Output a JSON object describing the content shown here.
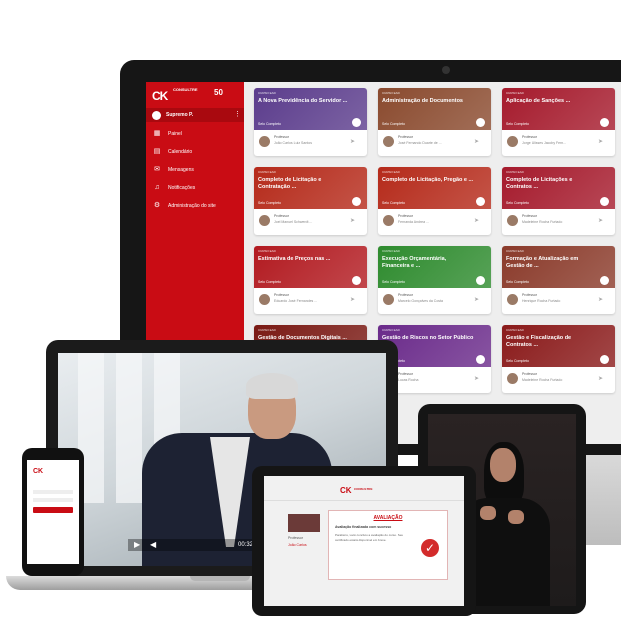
{
  "sidebar": {
    "logo": "CK",
    "brand": "CONSULTRE",
    "badge": "50",
    "user": "Supremo P.",
    "items": [
      {
        "label": "Painel",
        "icon": "dashboard-icon",
        "glyph": "▦"
      },
      {
        "label": "Calendário",
        "icon": "calendar-icon",
        "glyph": "▤"
      },
      {
        "label": "Mensagens",
        "icon": "messages-icon",
        "glyph": "✉"
      },
      {
        "label": "Notificações",
        "icon": "bell-icon",
        "glyph": "♫"
      },
      {
        "label": "Administração do site",
        "icon": "gear-icon",
        "glyph": "⚙"
      }
    ]
  },
  "courses": [
    {
      "tag": "CURSO EAD",
      "title": "A Nova Previdência do Servidor ...",
      "seal": "Selo Completo",
      "color": "#5b3c8c",
      "teacher_label": "Professor",
      "teacher": "João Carlos Luiz Santos"
    },
    {
      "tag": "CURSO EAD",
      "title": "Administração de Documentos",
      "seal": "Selo Completo",
      "color": "#8a4a2e",
      "teacher_label": "Professor",
      "teacher": "José Fernando Duarte de ..."
    },
    {
      "tag": "CURSO EAD",
      "title": "Aplicação de Sanções ...",
      "seal": "Selo Completo",
      "color": "#a51a2c",
      "teacher_label": "Professor",
      "teacher": "Jorge Ulisses Jacoby Fern..."
    },
    {
      "tag": "CURSO EAD",
      "title": "Completo de Licitação e Contratação ...",
      "seal": "Selo Completo",
      "color": "#b52a1a",
      "teacher_label": "Professor",
      "teacher": "Joel Manuel Schwerdt ..."
    },
    {
      "tag": "CURSO EAD",
      "title": "Completo de Licitação, Pregão e ...",
      "seal": "Selo Completo",
      "color": "#b52a1a",
      "teacher_label": "Professor",
      "teacher": "Fernanda Andrea ..."
    },
    {
      "tag": "CURSO EAD",
      "title": "Completo de Licitações e Contratos ...",
      "seal": "Selo Completo",
      "color": "#a51a2c",
      "teacher_label": "Professor",
      "teacher": "Madeleine Rocha Furtado"
    },
    {
      "tag": "CURSO EAD",
      "title": "Estimativa de Preços nas ...",
      "seal": "Selo Completo",
      "color": "#b21a20",
      "teacher_label": "Professor",
      "teacher": "Eduardo José Fernandes ..."
    },
    {
      "tag": "CURSO EAD",
      "title": "Execução Orçamentária, Financeira e ...",
      "seal": "Selo Completo",
      "color": "#2e8b2e",
      "teacher_label": "Professor",
      "teacher": "Marcelo Gonçalves da Costa"
    },
    {
      "tag": "CURSO EAD",
      "title": "Formação e Atualização em Gestão de ...",
      "seal": "Selo Completo",
      "color": "#8a3a2a",
      "teacher_label": "Professor",
      "teacher": "Henrique Rocha Furtado"
    },
    {
      "tag": "CURSO EAD",
      "title": "Gestão de Documentos Digitais ...",
      "seal": "Selo Completo",
      "color": "#7a1a14",
      "teacher_label": "Professor",
      "teacher": "Luiz ..."
    },
    {
      "tag": "CURSO EAD",
      "title": "Gestão de Riscos no Setor Público",
      "seal": "Selo Completo",
      "color": "#6a2a8a",
      "teacher_label": "Professor",
      "teacher": "Lucas Rocha"
    },
    {
      "tag": "CURSO EAD",
      "title": "Gestão e Fiscalização de Contratos ...",
      "seal": "Selo Completo",
      "color": "#8a1a1a",
      "teacher_label": "Professor",
      "teacher": "Madeleine Rocha Furtado"
    }
  ],
  "video": {
    "time": "00:32"
  },
  "phone": {
    "logo": "CK"
  },
  "tablet": {
    "logo": "CK",
    "brand": "CONSULTRE",
    "side_label": "Professor",
    "side_label2": "João Carlos",
    "dialog_title": "AVALIAÇÃO",
    "dialog_sub": "Avaliação finalizada com sucesso",
    "dialog_text": "Parabéns, você concluiu a avaliação do curso. Seu certificado estará disponível em breve."
  }
}
